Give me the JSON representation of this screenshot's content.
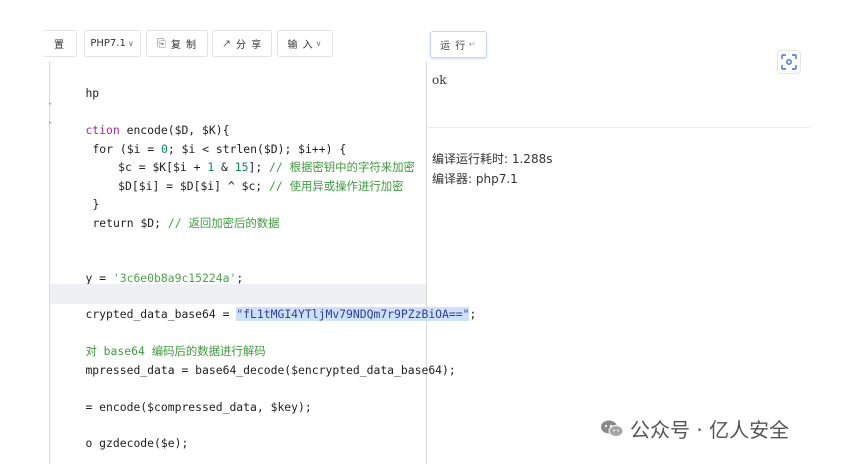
{
  "toolbar": {
    "settings_partial": "置",
    "version_label": "PHP7.1",
    "copy_label": "复 制",
    "share_label": "分 享",
    "input_label": "输 入",
    "run_label": "运 行"
  },
  "editor": {
    "lines": {
      "l1": "hp",
      "l3_kw": "ction",
      "l3_rest": " encode($D, $K){",
      "l4_a": "for ($i = ",
      "l4_b": "0",
      "l4_c": "; $i < strlen($D); $i++) {",
      "l5_a": "  $c = $K[$i + ",
      "l5_b": "1",
      "l5_c": " & ",
      "l5_d": "15",
      "l5_e": "]; ",
      "l5_cmt": "// 根据密钥中的字符来加密",
      "l6_a": "  $D[$i] = $D[$i] ^ $c; ",
      "l6_cmt": "// 使用异或操作进行加密",
      "l7": "}",
      "l8_a": "return $D; ",
      "l8_cmt": "// 返回加密后的数据",
      "l11_a": "y = ",
      "l11_str": "'3c6e0b8a9c15224a'",
      "l11_end": ";",
      "l13_a": "crypted_data_base64 = ",
      "l13_str": "\"fL1tMGI4YTljMv79NDQm7r9PZzBiOA==\"",
      "l13_end": ";",
      "l15_cmt": "对 base64 编码后的数据进行解码",
      "l16": "mpressed_data = base64_decode($encrypted_data_base64);",
      "l18": "= encode($compressed_data, $key);",
      "l20": "o gzdecode($e);"
    }
  },
  "output": {
    "result": "ok",
    "time_label": "编译运行耗时: 1.288s",
    "compiler_label": "编译器: php7.1"
  },
  "watermark": {
    "text": "公众号 · 亿人安全"
  }
}
